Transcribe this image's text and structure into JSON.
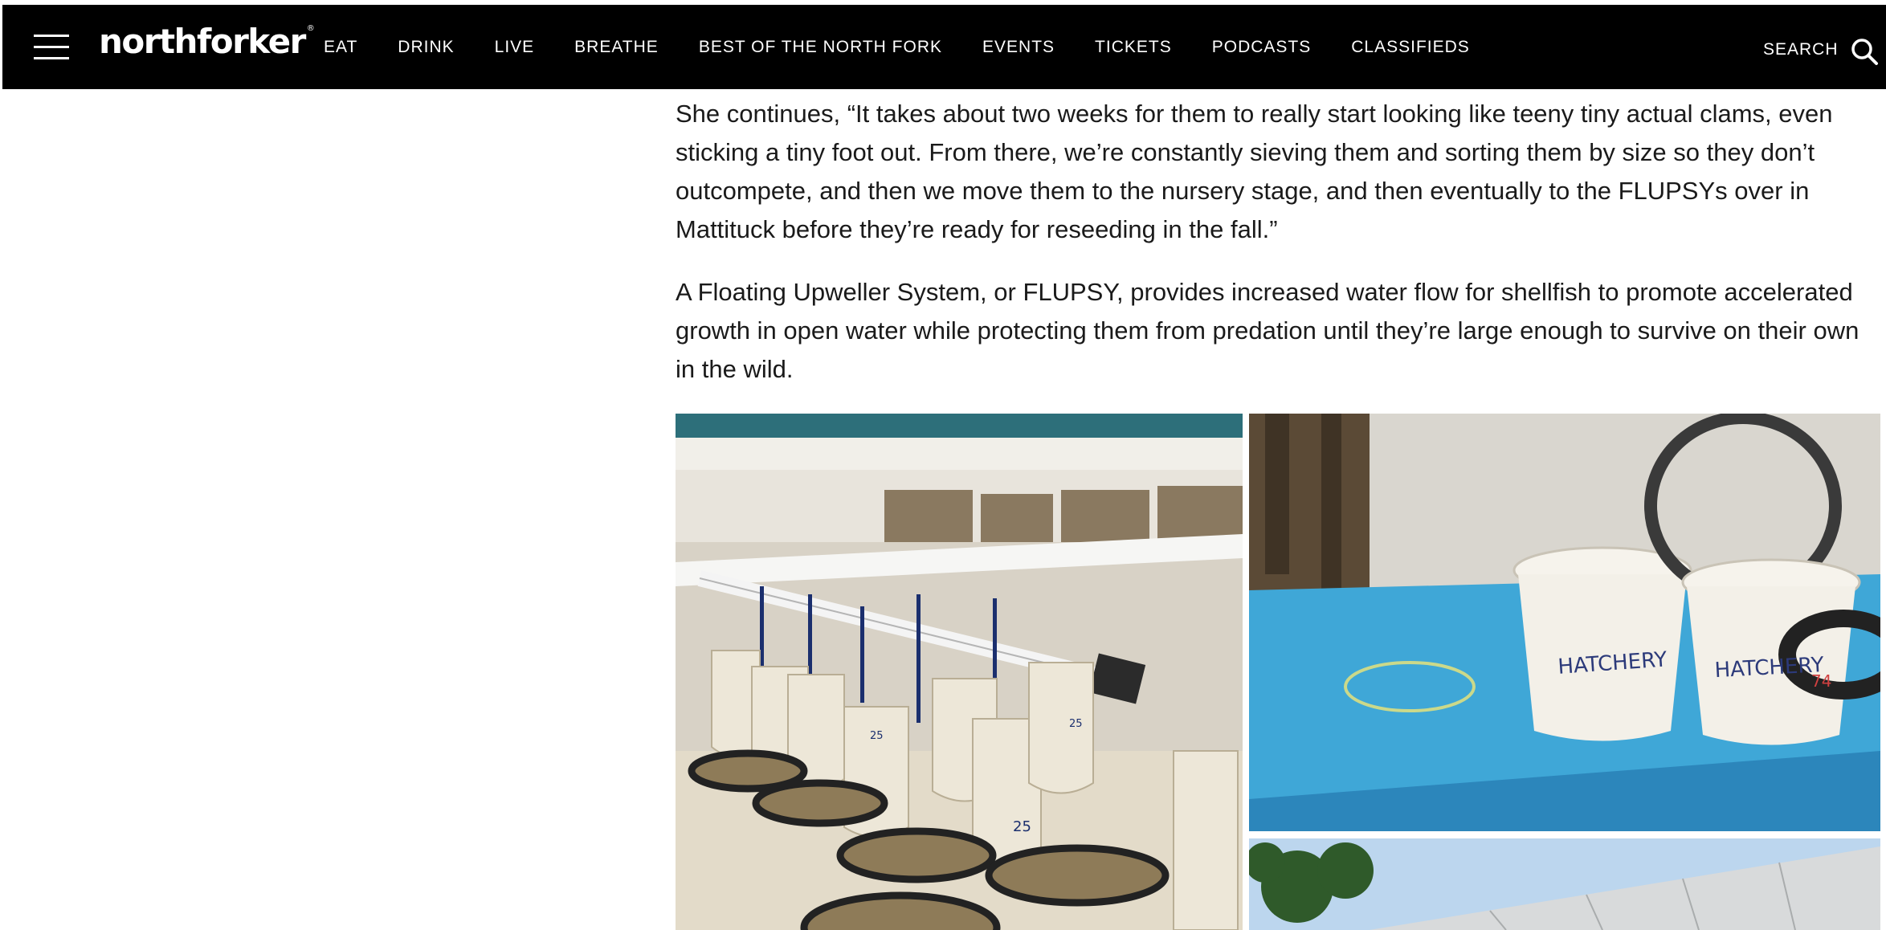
{
  "site": {
    "logo": "northforker",
    "logo_mark": "®"
  },
  "nav": {
    "items": [
      "EAT",
      "DRINK",
      "LIVE",
      "BREATHE",
      "BEST OF THE NORTH FORK",
      "EVENTS",
      "TICKETS",
      "PODCASTS",
      "CLASSIFIEDS"
    ],
    "search_label": "SEARCH"
  },
  "article": {
    "paragraphs": [
      "She continues, “It takes about two weeks for them to really start looking like teeny tiny actual clams, even sticking a tiny foot out. From there, we’re constantly sieving them and sorting them by size so they don’t outcompete, and then we move them to the nursery stage, and then eventually to the FLUPSYs over in Mattituck before they’re ready for reseeding in the fall.”",
      "A Floating Upweller System, or FLUPSY, provides increased water flow for shellfish to promote accelerated growth in open water while protecting them from predation until they’re large enough to survive on their own in the wild."
    ]
  },
  "photos": {
    "bucket_label_left": "HATCHERY",
    "bucket_label_right": "HATCHERY",
    "sieve_number": "74",
    "bag_number_1": "25",
    "bag_number_2": "25",
    "bag_number_3": "25"
  },
  "colors": {
    "nav_bg": "#000000",
    "nav_text": "#ffffff",
    "body_text": "#1a1a1a",
    "tray_blue": "#3fa7d7"
  }
}
